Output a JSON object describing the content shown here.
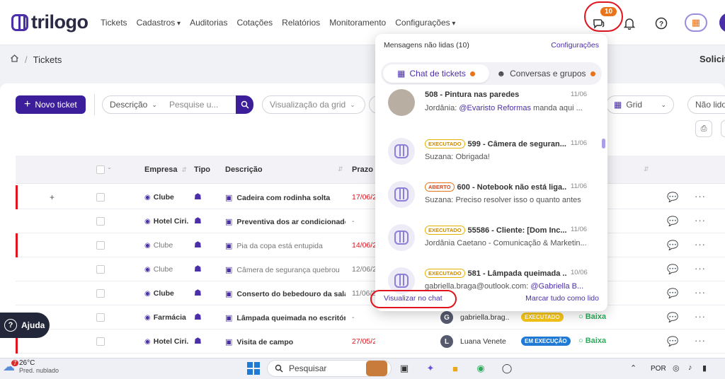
{
  "app": {
    "logo_text": "trilogo",
    "brand_color": "#3d1e9a",
    "accent_color": "#e8731a"
  },
  "nav": [
    "Tickets",
    "Cadastros",
    "Auditorias",
    "Cotações",
    "Relatórios",
    "Monitoramento",
    "Configurações"
  ],
  "topbar": {
    "chat_badge": "10",
    "icons": [
      "chat-icon",
      "bell-icon",
      "help-icon",
      "book-icon"
    ]
  },
  "breadcrumb": {
    "page": "Tickets",
    "right": "Solicit"
  },
  "toolbar": {
    "new_ticket": "Novo ticket",
    "filter_description": "Descrição",
    "search_placeholder": "Pesquise u...",
    "view_placeholder": "Visualização da grid",
    "view_mode": "Grid",
    "right_filter": "Não lido"
  },
  "table": {
    "headers": {
      "empresa": "Empresa",
      "tipo": "Tipo",
      "descricao": "Descrição",
      "prazo": "Prazo"
    },
    "rows": [
      {
        "empresa": "Clube",
        "descricao": "Cadeira com rodinha solta",
        "prazo": "17/06/2",
        "flag": true,
        "bold": true,
        "expand": "+"
      },
      {
        "empresa": "Hotel Ciri...",
        "descricao": "Preventiva dos ar condicionados",
        "prazo": "-",
        "flag": false,
        "bold": true
      },
      {
        "empresa": "Clube",
        "descricao": "Pia da copa está entupida",
        "prazo": "14/06/2",
        "flag": true,
        "bold": false
      },
      {
        "empresa": "Clube",
        "descricao": "Câmera de segurança quebrou",
        "prazo": "12/06/2",
        "flag": false,
        "bold": false
      },
      {
        "empresa": "Clube",
        "descricao": "Conserto do bebedouro da sala d...",
        "prazo": "11/06/2",
        "flag": false,
        "bold": true
      },
      {
        "empresa": "Farmácia",
        "descricao": "Lâmpada queimada no escritório",
        "prazo": "-",
        "flag": false,
        "bold": true,
        "person_initial": "G",
        "person": "gabriella.brag...",
        "status": "EXECUTADO",
        "priority": "Baixa"
      },
      {
        "empresa": "Hotel Ciri...",
        "descricao": "Visita de campo",
        "prazo": "27/05/2025",
        "flag": true,
        "bold": true,
        "person_initial": "L",
        "person": "Luana Venete",
        "status": "EM EXECUÇÃO",
        "priority": "Baixa"
      }
    ]
  },
  "help_button": "Ajuda",
  "panel": {
    "title": "Mensagens não lidas (10)",
    "config_link": "Configurações",
    "tab_tickets": "Chat de tickets",
    "tab_groups": "Conversas e grupos",
    "messages": [
      {
        "title": "508 - Pintura nas paredes",
        "date": "11/06",
        "sender": "Jordânia:",
        "mention": "@Evaristo Reformas",
        "text": " manda aqui ...",
        "status": ""
      },
      {
        "title": "599 - Câmera de seguran...",
        "date": "11/06",
        "sender": "Suzana:",
        "mention": "",
        "text": "Obrigada!",
        "status": "EXECUTADO"
      },
      {
        "title": "600 - Notebook não está liga...",
        "date": "11/06",
        "sender": "Suzana:",
        "mention": "",
        "text": "Preciso resolver isso o quanto antes",
        "status": "ABERTO"
      },
      {
        "title": "55586 - Cliente: [Dom Inc...",
        "date": "11/06",
        "sender": "Jordânia Caetano - Comunicação & Marketin...",
        "mention": "",
        "text": "",
        "status": "EXECUTADO"
      },
      {
        "title": "581 - Lâmpada queimada ...",
        "date": "10/06",
        "sender": "gabriella.braga@outlook.com:",
        "mention": "@Gabriella B...",
        "text": "",
        "status": "EXECUTADO"
      }
    ],
    "view_in_chat": "Visualizar no chat",
    "mark_all_read": "Marcar tudo como lido"
  },
  "taskbar": {
    "temp": "26°C",
    "weather": "Pred. nublado",
    "weather_badge": "7",
    "search": "Pesquisar",
    "lang": "POR"
  }
}
